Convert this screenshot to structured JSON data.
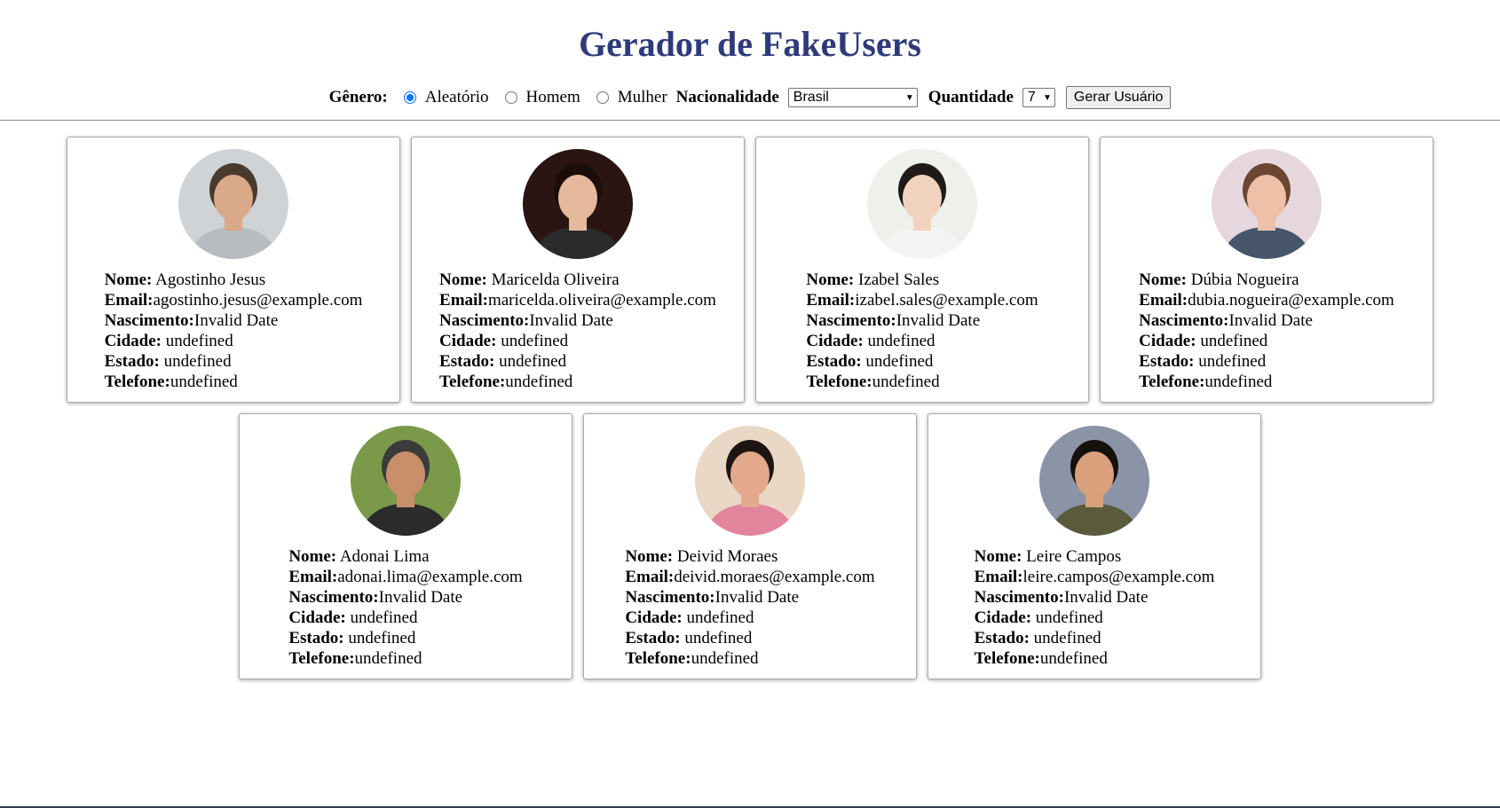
{
  "header": {
    "title": "Gerador de FakeUsers"
  },
  "controls": {
    "genero_label": "Gênero:",
    "genero_options": [
      {
        "label": "Aleatório",
        "checked": true
      },
      {
        "label": "Homem",
        "checked": false
      },
      {
        "label": "Mulher",
        "checked": false
      }
    ],
    "nacionalidade_label": "Nacionalidade",
    "nacionalidade_value": "Brasil",
    "quantidade_label": "Quantidade",
    "quantidade_value": "7",
    "button_label": "Gerar Usuário"
  },
  "field_labels": {
    "nome": "Nome:",
    "email": "Email:",
    "nascimento": "Nascimento:",
    "cidade": "Cidade:",
    "estado": "Estado:",
    "telefone": "Telefone:"
  },
  "users": [
    {
      "nome": "Agostinho Jesus",
      "email": "agostinho.jesus@example.com",
      "nascimento": "Invalid Date",
      "cidade": "undefined",
      "estado": "undefined",
      "telefone": "undefined",
      "avatar": {
        "bg": "#cfd3d6",
        "skin": "#d9a98a",
        "hair": "#4a3a2e",
        "shirt": "#b8bcc0"
      }
    },
    {
      "nome": "Maricelda Oliveira",
      "email": "maricelda.oliveira@example.com",
      "nascimento": "Invalid Date",
      "cidade": "undefined",
      "estado": "undefined",
      "telefone": "undefined",
      "avatar": {
        "bg": "#2a1512",
        "skin": "#e6b99c",
        "hair": "#1a0d0a",
        "shirt": "#2b2b2b"
      }
    },
    {
      "nome": "Izabel Sales",
      "email": "izabel.sales@example.com",
      "nascimento": "Invalid Date",
      "cidade": "undefined",
      "estado": "undefined",
      "telefone": "undefined",
      "avatar": {
        "bg": "#eef0ec",
        "skin": "#f1d3bd",
        "hair": "#1f1a18",
        "shirt": "#f4f4f4"
      }
    },
    {
      "nome": "Dúbia Nogueira",
      "email": "dubia.nogueira@example.com",
      "nascimento": "Invalid Date",
      "cidade": "undefined",
      "estado": "undefined",
      "telefone": "undefined",
      "avatar": {
        "bg": "#e6d7de",
        "skin": "#eec0a8",
        "hair": "#6b4632",
        "shirt": "#47566b"
      }
    },
    {
      "nome": "Adonai Lima",
      "email": "adonai.lima@example.com",
      "nascimento": "Invalid Date",
      "cidade": "undefined",
      "estado": "undefined",
      "telefone": "undefined",
      "avatar": {
        "bg": "#7a9a4a",
        "skin": "#c98f6a",
        "hair": "#3b3b3b",
        "shirt": "#2b2b2b"
      }
    },
    {
      "nome": "Deivid Moraes",
      "email": "deivid.moraes@example.com",
      "nascimento": "Invalid Date",
      "cidade": "undefined",
      "estado": "undefined",
      "telefone": "undefined",
      "avatar": {
        "bg": "#e9d8c6",
        "skin": "#e3a98c",
        "hair": "#1e1512",
        "shirt": "#e2849c"
      }
    },
    {
      "nome": "Leire Campos",
      "email": "leire.campos@example.com",
      "nascimento": "Invalid Date",
      "cidade": "undefined",
      "estado": "undefined",
      "telefone": "undefined",
      "avatar": {
        "bg": "#8b93a6",
        "skin": "#d9a07c",
        "hair": "#15110f",
        "shirt": "#5a5a3c"
      }
    }
  ]
}
